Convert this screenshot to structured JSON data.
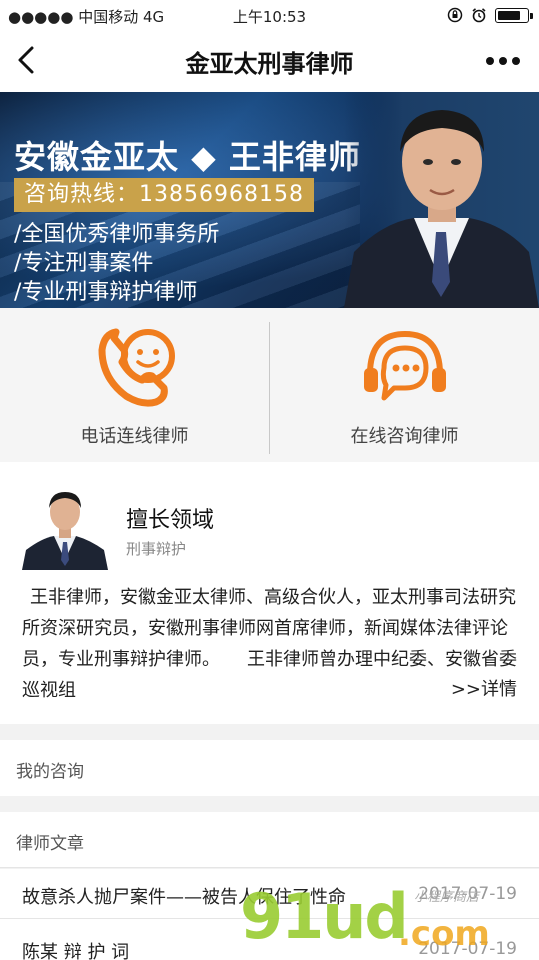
{
  "status_bar": {
    "carrier": "●●●●● 中国移动  4G",
    "time": "上午10:53"
  },
  "nav": {
    "title": "金亚太刑事律师"
  },
  "banner": {
    "headline": "安徽金亚太 ◆ 王非律师",
    "hotline": "咨询热线：13856968158",
    "lines": [
      "/全国优秀律师事务所",
      "/专注刑事案件",
      "/专业刑事辩护律师"
    ],
    "dot_active_color": "#2b2b2b",
    "dot_inactive_color": "#777777"
  },
  "actions": [
    {
      "label": "电话连线律师",
      "icon": "phone-smile-icon"
    },
    {
      "label": "在线咨询律师",
      "icon": "headset-chat-icon"
    }
  ],
  "accent_color": "#f07d1e",
  "profile": {
    "title": "擅长领域",
    "subtitle": "刑事辩护",
    "description": "王非律师，安徽金亚太律师、高级合伙人，亚太刑事司法研究所资深研究员，安徽刑事律师网首席律师，新闻媒体法律评论员，专业刑事辩护律师。　　王非律师曾办理中纪委、安徽省委巡视组",
    "more_label": ">>详情"
  },
  "sections": {
    "my_consult": "我的咨询",
    "articles": "律师文章"
  },
  "articles": [
    {
      "title": "故意杀人抛尸案件——被告人保住了性命",
      "date": "2017-07-19"
    },
    {
      "title": "陈某 辩 护 词",
      "date": "2017-07-19"
    }
  ],
  "watermark": {
    "main": "91ud",
    "suffix": ".com",
    "small": "小程序商店"
  }
}
